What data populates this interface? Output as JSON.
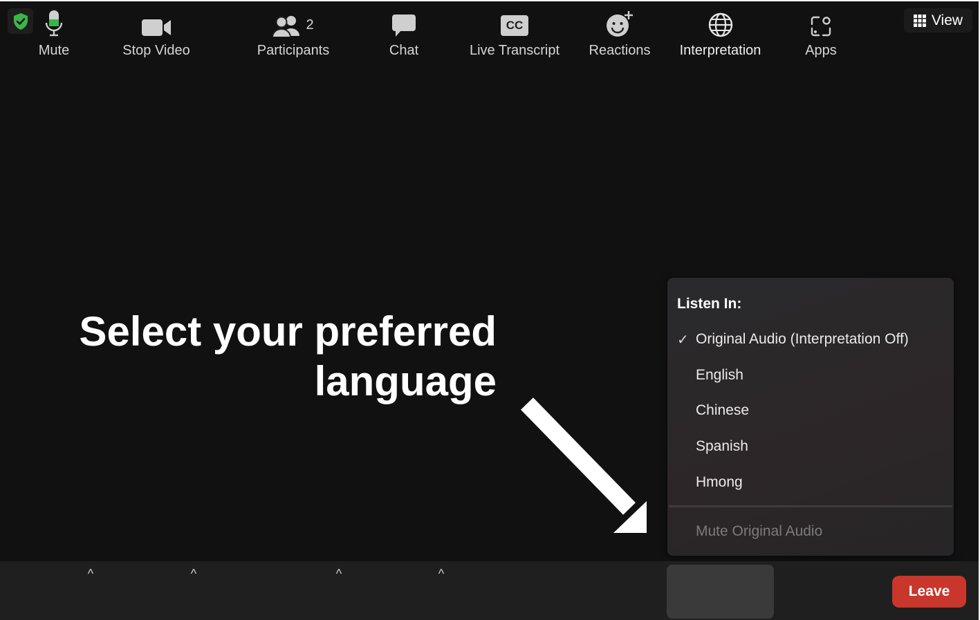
{
  "top_bar": {
    "view_label": "View"
  },
  "overlay": {
    "line1": "Select your preferred",
    "line2": "language"
  },
  "interpretation_menu": {
    "heading": "Listen In:",
    "items": [
      {
        "label": "Original Audio (Interpretation Off)",
        "checked": true
      },
      {
        "label": "English",
        "checked": false
      },
      {
        "label": "Chinese",
        "checked": false
      },
      {
        "label": "Spanish",
        "checked": false
      },
      {
        "label": "Hmong",
        "checked": false
      }
    ],
    "check_glyph": "✓",
    "mute_original": "Mute Original Audio"
  },
  "toolbar": {
    "mute": "Mute",
    "stop_video": "Stop Video",
    "participants": "Participants",
    "participants_count": "2",
    "chat": "Chat",
    "live_transcript": "Live Transcript",
    "cc_badge": "CC",
    "reactions": "Reactions",
    "interpretation": "Interpretation",
    "apps": "Apps",
    "leave": "Leave",
    "caret": "^"
  },
  "colors": {
    "background": "#111111",
    "toolbar": "#1f1f1f",
    "leave": "#c9362c",
    "shield_green": "#3bb54a",
    "mic_green": "#3bb54a"
  },
  "icons": [
    "shield-check-icon",
    "grid-icon",
    "microphone-icon",
    "video-camera-icon",
    "participants-icon",
    "chat-bubble-icon",
    "cc-icon",
    "reaction-icon",
    "globe-icon",
    "apps-icon",
    "arrow-icon"
  ]
}
